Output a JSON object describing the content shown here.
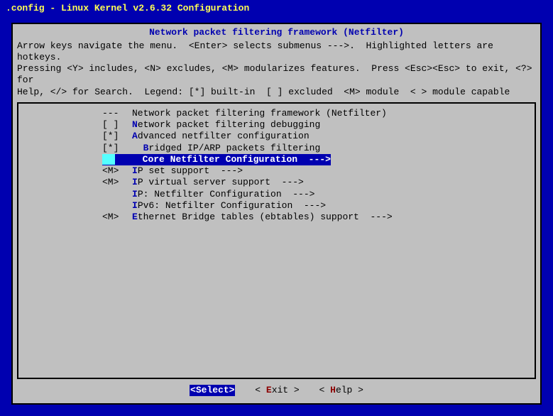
{
  "window_title": ".config - Linux Kernel v2.6.32 Configuration",
  "panel_title": "Network packet filtering framework (Netfilter)",
  "help_lines": {
    "l1a": "Arrow keys navigate the menu.  <Enter> selects submenus --->.  Highlighted letters are hotkeys.",
    "l2a": "Pressing <Y> includes, <N> excludes, <M> modularizes features.  Press <Esc><Esc> to exit, <?> for",
    "l3a": "Help, </> for Search.  Legend: [*] built-in  [ ] excluded  <M> module  < > module capable"
  },
  "menu": {
    "header_indicator": "---",
    "header_text": "Network packet filtering framework (Netfilter)",
    "items": [
      {
        "indicator": "[ ]",
        "hot": "N",
        "rest": "etwork packet filtering debugging"
      },
      {
        "indicator": "[*]",
        "hot": "A",
        "rest": "dvanced netfilter configuration"
      },
      {
        "indicator": "[*]",
        "pre": "  ",
        "hot": "B",
        "rest": "ridged IP/ARP packets filtering"
      },
      {
        "indicator": "   ",
        "pre": "  ",
        "hot": "C",
        "rest": "ore Netfilter Configuration  --->",
        "selected": true,
        "ind_text": "  "
      },
      {
        "indicator": "<M>",
        "hot": "I",
        "rest": "P set support  --->"
      },
      {
        "indicator": "<M>",
        "hot": "I",
        "rest": "P virtual server support  --->"
      },
      {
        "indicator": "   ",
        "hot": "I",
        "rest": "P: Netfilter Configuration  --->"
      },
      {
        "indicator": "   ",
        "hot": "I",
        "rest": "Pv6: Netfilter Configuration  --->"
      },
      {
        "indicator": "<M>",
        "hot": "E",
        "rest": "thernet Bridge tables (ebtables) support  --->"
      }
    ]
  },
  "buttons": {
    "select": {
      "label": "Select",
      "lt": "<",
      "gt": ">"
    },
    "exit": {
      "pre": "< ",
      "hot": "E",
      "rest": "xit >",
      "full": "< Exit >"
    },
    "help": {
      "pre": "< ",
      "hot": "H",
      "rest": "elp >",
      "full": "< Help >"
    }
  }
}
